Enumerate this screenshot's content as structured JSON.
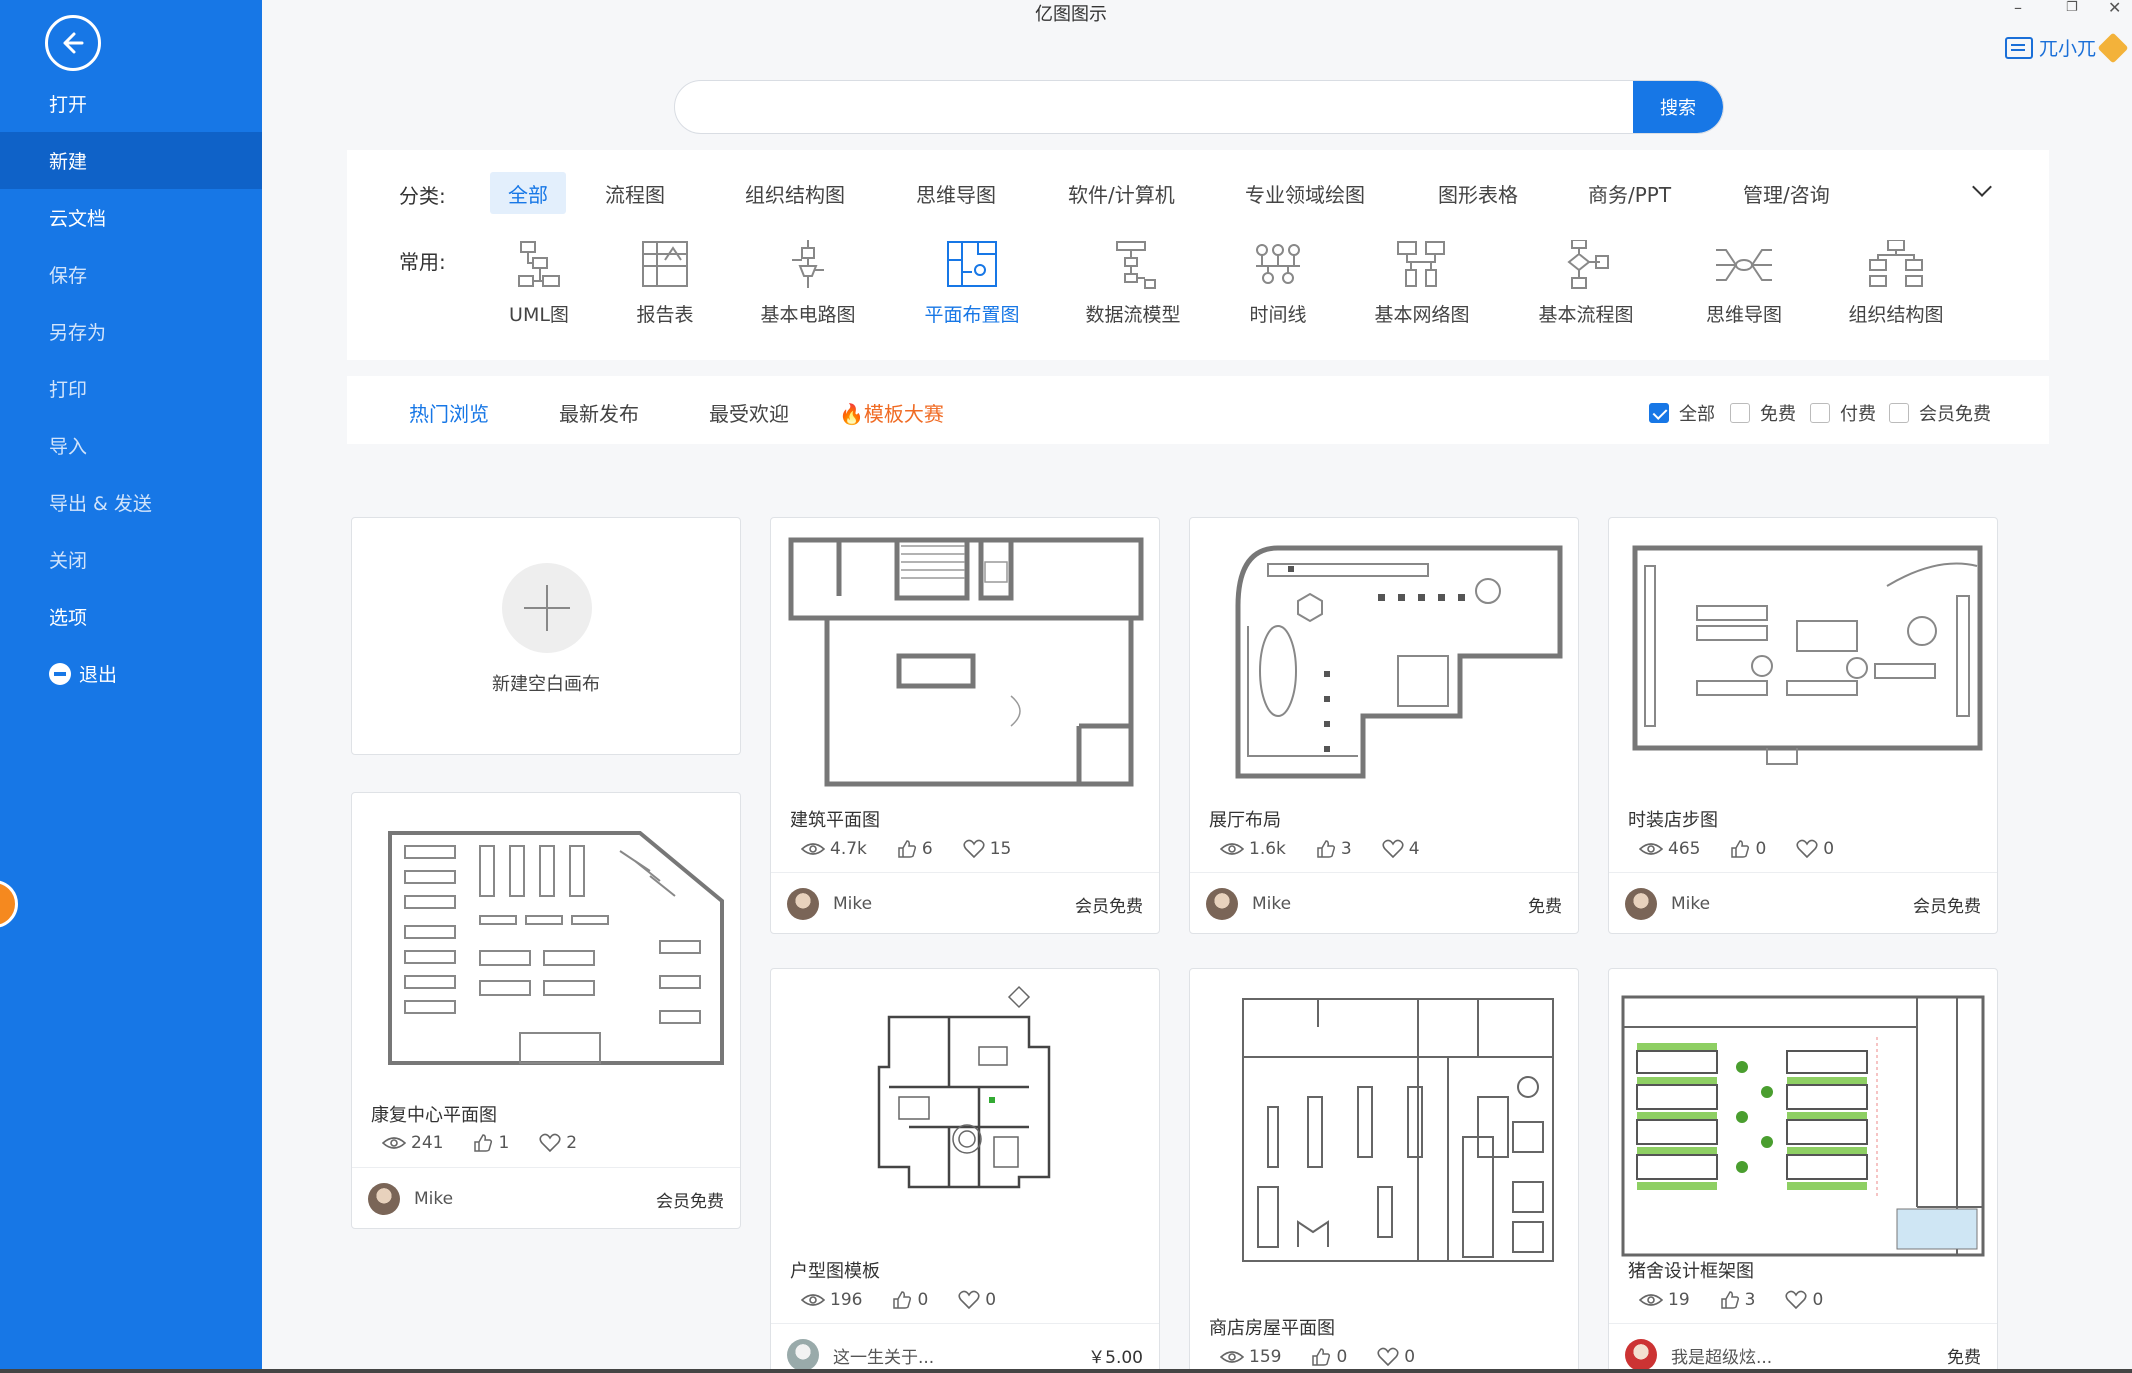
{
  "app_title": "亿图图示",
  "user": {
    "name": "兀小兀"
  },
  "sidebar": {
    "items": [
      {
        "label": "打开"
      },
      {
        "label": "新建"
      },
      {
        "label": "云文档"
      },
      {
        "label": "保存"
      },
      {
        "label": "另存为"
      },
      {
        "label": "打印"
      },
      {
        "label": "导入"
      },
      {
        "label": "导出 & 发送"
      },
      {
        "label": "关闭"
      },
      {
        "label": "选项"
      },
      {
        "label": "退出"
      }
    ]
  },
  "search": {
    "value": "",
    "button": "搜索"
  },
  "categories": {
    "label": "分类:",
    "items": [
      "全部",
      "流程图",
      "组织结构图",
      "思维导图",
      "软件/计算机",
      "专业领域绘图",
      "图形表格",
      "商务/PPT",
      "管理/咨询"
    ]
  },
  "common": {
    "label": "常用:",
    "items": [
      {
        "label": "UML图",
        "icon": "uml-icon"
      },
      {
        "label": "报告表",
        "icon": "report-icon"
      },
      {
        "label": "基本电路图",
        "icon": "circuit-icon"
      },
      {
        "label": "平面布置图",
        "icon": "floorplan-icon"
      },
      {
        "label": "数据流模型",
        "icon": "dataflow-icon"
      },
      {
        "label": "时间线",
        "icon": "timeline-icon"
      },
      {
        "label": "基本网络图",
        "icon": "network-icon"
      },
      {
        "label": "基本流程图",
        "icon": "flowchart-icon"
      },
      {
        "label": "思维导图",
        "icon": "mindmap-icon"
      },
      {
        "label": "组织结构图",
        "icon": "orgchart-icon"
      }
    ]
  },
  "tabs": [
    "热门浏览",
    "最新发布",
    "最受欢迎",
    "模板大赛"
  ],
  "filters": [
    {
      "label": "全部",
      "checked": true
    },
    {
      "label": "免费",
      "checked": false
    },
    {
      "label": "付费",
      "checked": false
    },
    {
      "label": "会员免费",
      "checked": false
    }
  ],
  "blank": {
    "label": "新建空白画布"
  },
  "cards": [
    {
      "title": "建筑平面图",
      "views": "4.7k",
      "likes": "6",
      "favs": "15",
      "author": "Mike",
      "price": "会员免费"
    },
    {
      "title": "展厅布局",
      "views": "1.6k",
      "likes": "3",
      "favs": "4",
      "author": "Mike",
      "price": "免费"
    },
    {
      "title": "时装店步图",
      "views": "465",
      "likes": "0",
      "favs": "0",
      "author": "Mike",
      "price": "会员免费"
    },
    {
      "title": "康复中心平面图",
      "views": "241",
      "likes": "1",
      "favs": "2",
      "author": "Mike",
      "price": "会员免费"
    },
    {
      "title": "户型图模板",
      "views": "196",
      "likes": "0",
      "favs": "0",
      "author": "这一生关于...",
      "price": "￥5.00"
    },
    {
      "title": "商店房屋平面图",
      "views": "159",
      "likes": "0",
      "favs": "0",
      "author": "",
      "price": ""
    },
    {
      "title": "猪舍设计框架图",
      "views": "19",
      "likes": "3",
      "favs": "0",
      "author": "我是超级炫...",
      "price": "免费"
    }
  ],
  "colors": {
    "primary": "#1777e6",
    "sidebar_active": "#0f62c8",
    "hot": "#f06b24"
  }
}
